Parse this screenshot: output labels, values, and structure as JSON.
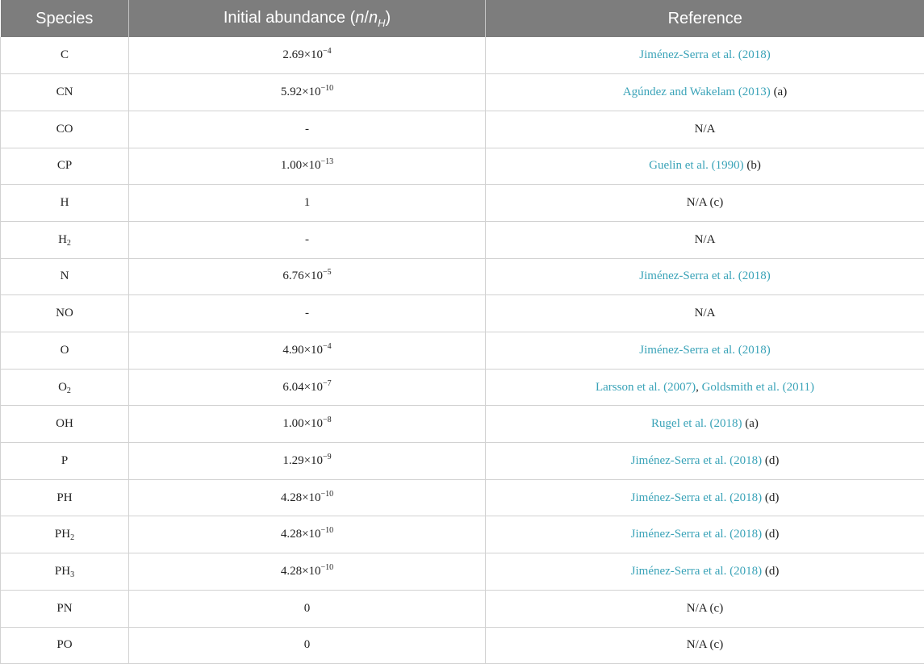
{
  "header": {
    "species": "Species",
    "abundance_prefix": "Initial abundance (",
    "abundance_n": "n",
    "abundance_slash": "/",
    "abundance_nh": "n",
    "abundance_sub": "H",
    "abundance_suffix": ")",
    "reference": "Reference"
  },
  "rows": [
    {
      "sp": "C",
      "sp_sub": "",
      "mant": "2.69",
      "times": "×",
      "base": "10",
      "exp": "−4",
      "plain": "",
      "refs": [
        {
          "text": "Jiménez-Serra et al. (2018)",
          "link": true
        }
      ]
    },
    {
      "sp": "CN",
      "sp_sub": "",
      "mant": "5.92",
      "times": "×",
      "base": "10",
      "exp": "−10",
      "plain": "",
      "refs": [
        {
          "text": "Agúndez and Wakelam (2013)",
          "link": true
        },
        {
          "text": " (a)",
          "link": false
        }
      ]
    },
    {
      "sp": "CO",
      "sp_sub": "",
      "mant": "",
      "times": "",
      "base": "",
      "exp": "",
      "plain": "-",
      "refs": [
        {
          "text": "N/A",
          "link": false
        }
      ]
    },
    {
      "sp": "CP",
      "sp_sub": "",
      "mant": "1.00",
      "times": "×",
      "base": "10",
      "exp": "−13",
      "plain": "",
      "refs": [
        {
          "text": "Guelin et al. (1990)",
          "link": true
        },
        {
          "text": " (b)",
          "link": false
        }
      ]
    },
    {
      "sp": "H",
      "sp_sub": "",
      "mant": "",
      "times": "",
      "base": "",
      "exp": "",
      "plain": "1",
      "refs": [
        {
          "text": "N/A (c)",
          "link": false
        }
      ]
    },
    {
      "sp": "H",
      "sp_sub": "2",
      "mant": "",
      "times": "",
      "base": "",
      "exp": "",
      "plain": "-",
      "refs": [
        {
          "text": "N/A",
          "link": false
        }
      ]
    },
    {
      "sp": "N",
      "sp_sub": "",
      "mant": "6.76",
      "times": "×",
      "base": "10",
      "exp": "−5",
      "plain": "",
      "refs": [
        {
          "text": "Jiménez-Serra et al. (2018)",
          "link": true
        }
      ]
    },
    {
      "sp": "NO",
      "sp_sub": "",
      "mant": "",
      "times": "",
      "base": "",
      "exp": "",
      "plain": "-",
      "refs": [
        {
          "text": "N/A",
          "link": false
        }
      ]
    },
    {
      "sp": "O",
      "sp_sub": "",
      "mant": "4.90",
      "times": "×",
      "base": "10",
      "exp": "−4",
      "plain": "",
      "refs": [
        {
          "text": "Jiménez-Serra et al. (2018)",
          "link": true
        }
      ]
    },
    {
      "sp": "O",
      "sp_sub": "2",
      "mant": "6.04",
      "times": "×",
      "base": "10",
      "exp": "−7",
      "plain": "",
      "refs": [
        {
          "text": "Larsson et al. (2007)",
          "link": true
        },
        {
          "text": ", ",
          "link": false
        },
        {
          "text": "Goldsmith et al. (2011)",
          "link": true
        }
      ]
    },
    {
      "sp": "OH",
      "sp_sub": "",
      "mant": "1.00",
      "times": "×",
      "base": "10",
      "exp": "−8",
      "plain": "",
      "refs": [
        {
          "text": "Rugel et al. (2018)",
          "link": true
        },
        {
          "text": " (a)",
          "link": false
        }
      ]
    },
    {
      "sp": "P",
      "sp_sub": "",
      "mant": "1.29",
      "times": "×",
      "base": "10",
      "exp": "−9",
      "plain": "",
      "refs": [
        {
          "text": "Jiménez-Serra et al. (2018)",
          "link": true
        },
        {
          "text": " (d)",
          "link": false
        }
      ]
    },
    {
      "sp": "PH",
      "sp_sub": "",
      "mant": "4.28",
      "times": "×",
      "base": "10",
      "exp": "−10",
      "plain": "",
      "refs": [
        {
          "text": "Jiménez-Serra et al. (2018)",
          "link": true
        },
        {
          "text": " (d)",
          "link": false
        }
      ]
    },
    {
      "sp": "PH",
      "sp_sub": "2",
      "mant": "4.28",
      "times": "×",
      "base": "10",
      "exp": "−10",
      "plain": "",
      "refs": [
        {
          "text": "Jiménez-Serra et al. (2018)",
          "link": true
        },
        {
          "text": " (d)",
          "link": false
        }
      ]
    },
    {
      "sp": "PH",
      "sp_sub": "3",
      "mant": "4.28",
      "times": "×",
      "base": "10",
      "exp": "−10",
      "plain": "",
      "refs": [
        {
          "text": "Jiménez-Serra et al. (2018)",
          "link": true
        },
        {
          "text": " (d)",
          "link": false
        }
      ]
    },
    {
      "sp": "PN",
      "sp_sub": "",
      "mant": "",
      "times": "",
      "base": "",
      "exp": "",
      "plain": "0",
      "refs": [
        {
          "text": "N/A (c)",
          "link": false
        }
      ]
    },
    {
      "sp": "PO",
      "sp_sub": "",
      "mant": "",
      "times": "",
      "base": "",
      "exp": "",
      "plain": "0",
      "refs": [
        {
          "text": "N/A (c)",
          "link": false
        }
      ]
    }
  ],
  "colors": {
    "header_bg": "#7d7d7d",
    "header_text": "#ffffff",
    "link": "#3aa3b8",
    "grid": "#d2d2d2"
  }
}
